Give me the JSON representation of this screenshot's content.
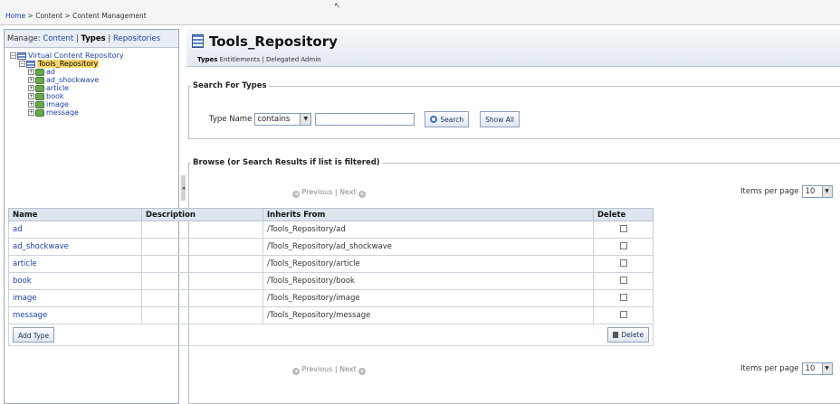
{
  "breadcrumb": {
    "home": "Home",
    "sep": " > ",
    "content": "Content",
    "current": "Content Management"
  },
  "left": {
    "manage_label": "Manage: ",
    "manage_links": [
      "Content",
      "Types",
      "Repositories"
    ],
    "tree": {
      "root": "Virtual Content Repository",
      "repo": "Tools_Repository",
      "types": [
        "ad",
        "ad_shockwave",
        "article",
        "book",
        "image",
        "message"
      ]
    }
  },
  "main": {
    "title": "Tools_Repository",
    "tabs": [
      "Types",
      "Entitlements",
      "Delegated Admin"
    ],
    "search": {
      "legend": "Search For Types",
      "type_name_label": "Type Name",
      "match_option": "contains",
      "input_value": "",
      "search_button": "Search",
      "show_all_button": "Show All"
    },
    "browse": {
      "legend": "Browse (or Search Results if list is filtered)",
      "prev": "Previous",
      "next": "Next",
      "items_per_page_label": "Items per page",
      "items_per_page": "10",
      "columns": [
        "Name",
        "Description",
        "Inherits From",
        "Delete"
      ],
      "rows": [
        {
          "name": "ad",
          "description": "",
          "inherits": "/Tools_Repository/ad"
        },
        {
          "name": "ad_shockwave",
          "description": "",
          "inherits": "/Tools_Repository/ad_shockwave"
        },
        {
          "name": "article",
          "description": "",
          "inherits": "/Tools_Repository/article"
        },
        {
          "name": "book",
          "description": "",
          "inherits": "/Tools_Repository/book"
        },
        {
          "name": "image",
          "description": "",
          "inherits": "/Tools_Repository/image"
        },
        {
          "name": "message",
          "description": "",
          "inherits": "/Tools_Repository/message"
        }
      ],
      "add_type_button": "Add Type",
      "delete_button": "Delete"
    }
  }
}
